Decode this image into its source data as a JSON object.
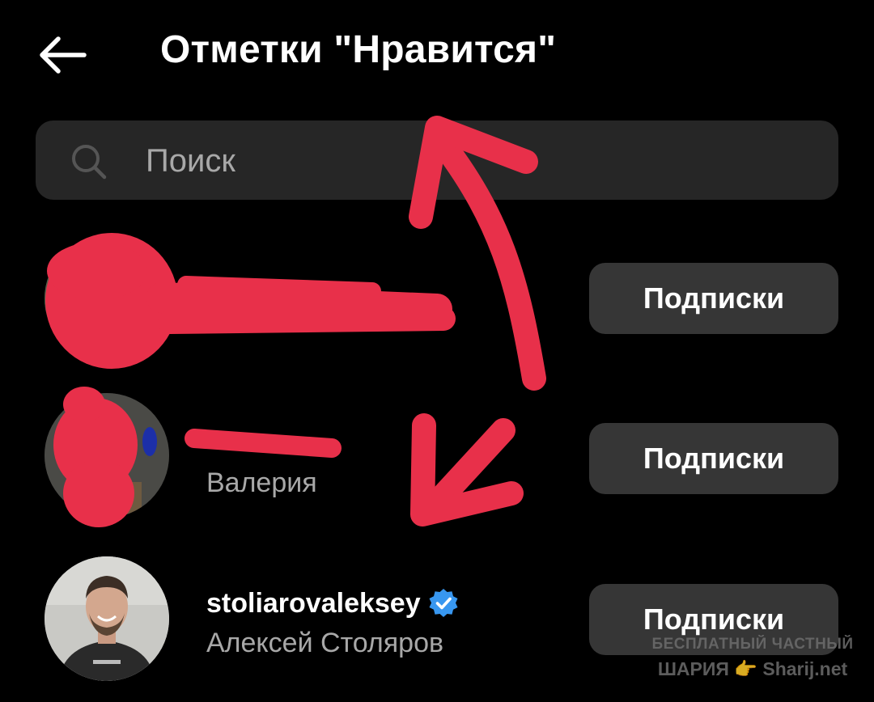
{
  "header": {
    "title": "Отметки \"Нравится\""
  },
  "search": {
    "placeholder": "Поиск"
  },
  "users": [
    {
      "username": "",
      "full_name": "",
      "button_label": "Подписки"
    },
    {
      "username": "",
      "full_name": "Валерия",
      "button_label": "Подписки"
    },
    {
      "username": "stoliarovaleksey",
      "full_name": "Алексей Столяров",
      "button_label": "Подписки",
      "verified": true
    }
  ],
  "watermark": {
    "line1": "БЕСПЛАТНЫЙ ЧАСТНЫЙ",
    "line2_left": "ШАРИЯ",
    "line2_right": "Sharij.net"
  },
  "colors": {
    "background": "#000000",
    "search_bg": "#262626",
    "button_bg": "#363636",
    "secondary_text": "#a8a8a8",
    "verified_badge": "#3897f0",
    "annotation": "#e8304a"
  },
  "icons": [
    "back-arrow-icon",
    "search-icon",
    "verified-badge-icon",
    "pointing-hand-icon"
  ]
}
